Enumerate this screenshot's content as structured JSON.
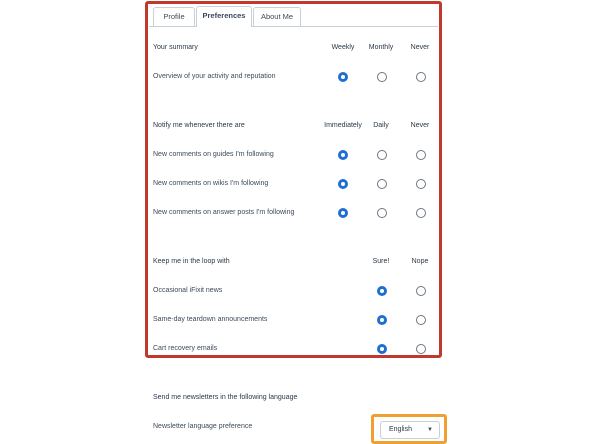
{
  "tabs": [
    {
      "label": "Profile",
      "active": false
    },
    {
      "label": "Preferences",
      "active": true
    },
    {
      "label": "About Me",
      "active": false
    }
  ],
  "summary": {
    "heading": "Your summary",
    "columns": [
      "Weekly",
      "Monthly",
      "Never"
    ],
    "rows": [
      {
        "label": "Overview of your activity and reputation",
        "selected": 0
      }
    ]
  },
  "notify": {
    "heading": "Notify me whenever there are",
    "columns": [
      "Immediately",
      "Daily",
      "Never"
    ],
    "rows": [
      {
        "label": "New comments on guides I'm following",
        "selected": 0
      },
      {
        "label": "New comments on wikis I'm following",
        "selected": 0
      },
      {
        "label": "New comments on answer posts I'm following",
        "selected": 0
      }
    ]
  },
  "loop": {
    "heading": "Keep me in the loop with",
    "columns": [
      "Sure!",
      "Nope"
    ],
    "rows": [
      {
        "label": "Occasional iFixit news",
        "selected": 0
      },
      {
        "label": "Same-day teardown announcements",
        "selected": 0
      },
      {
        "label": "Cart recovery emails",
        "selected": 0
      }
    ]
  },
  "newsletter": {
    "heading": "Send me newsletters in the following language",
    "label": "Newsletter language preference",
    "selected_language": "English"
  },
  "colors": {
    "highlight_red": "#c0392b",
    "highlight_orange": "#f0a030",
    "radio_selected": "#1f6fd1"
  }
}
